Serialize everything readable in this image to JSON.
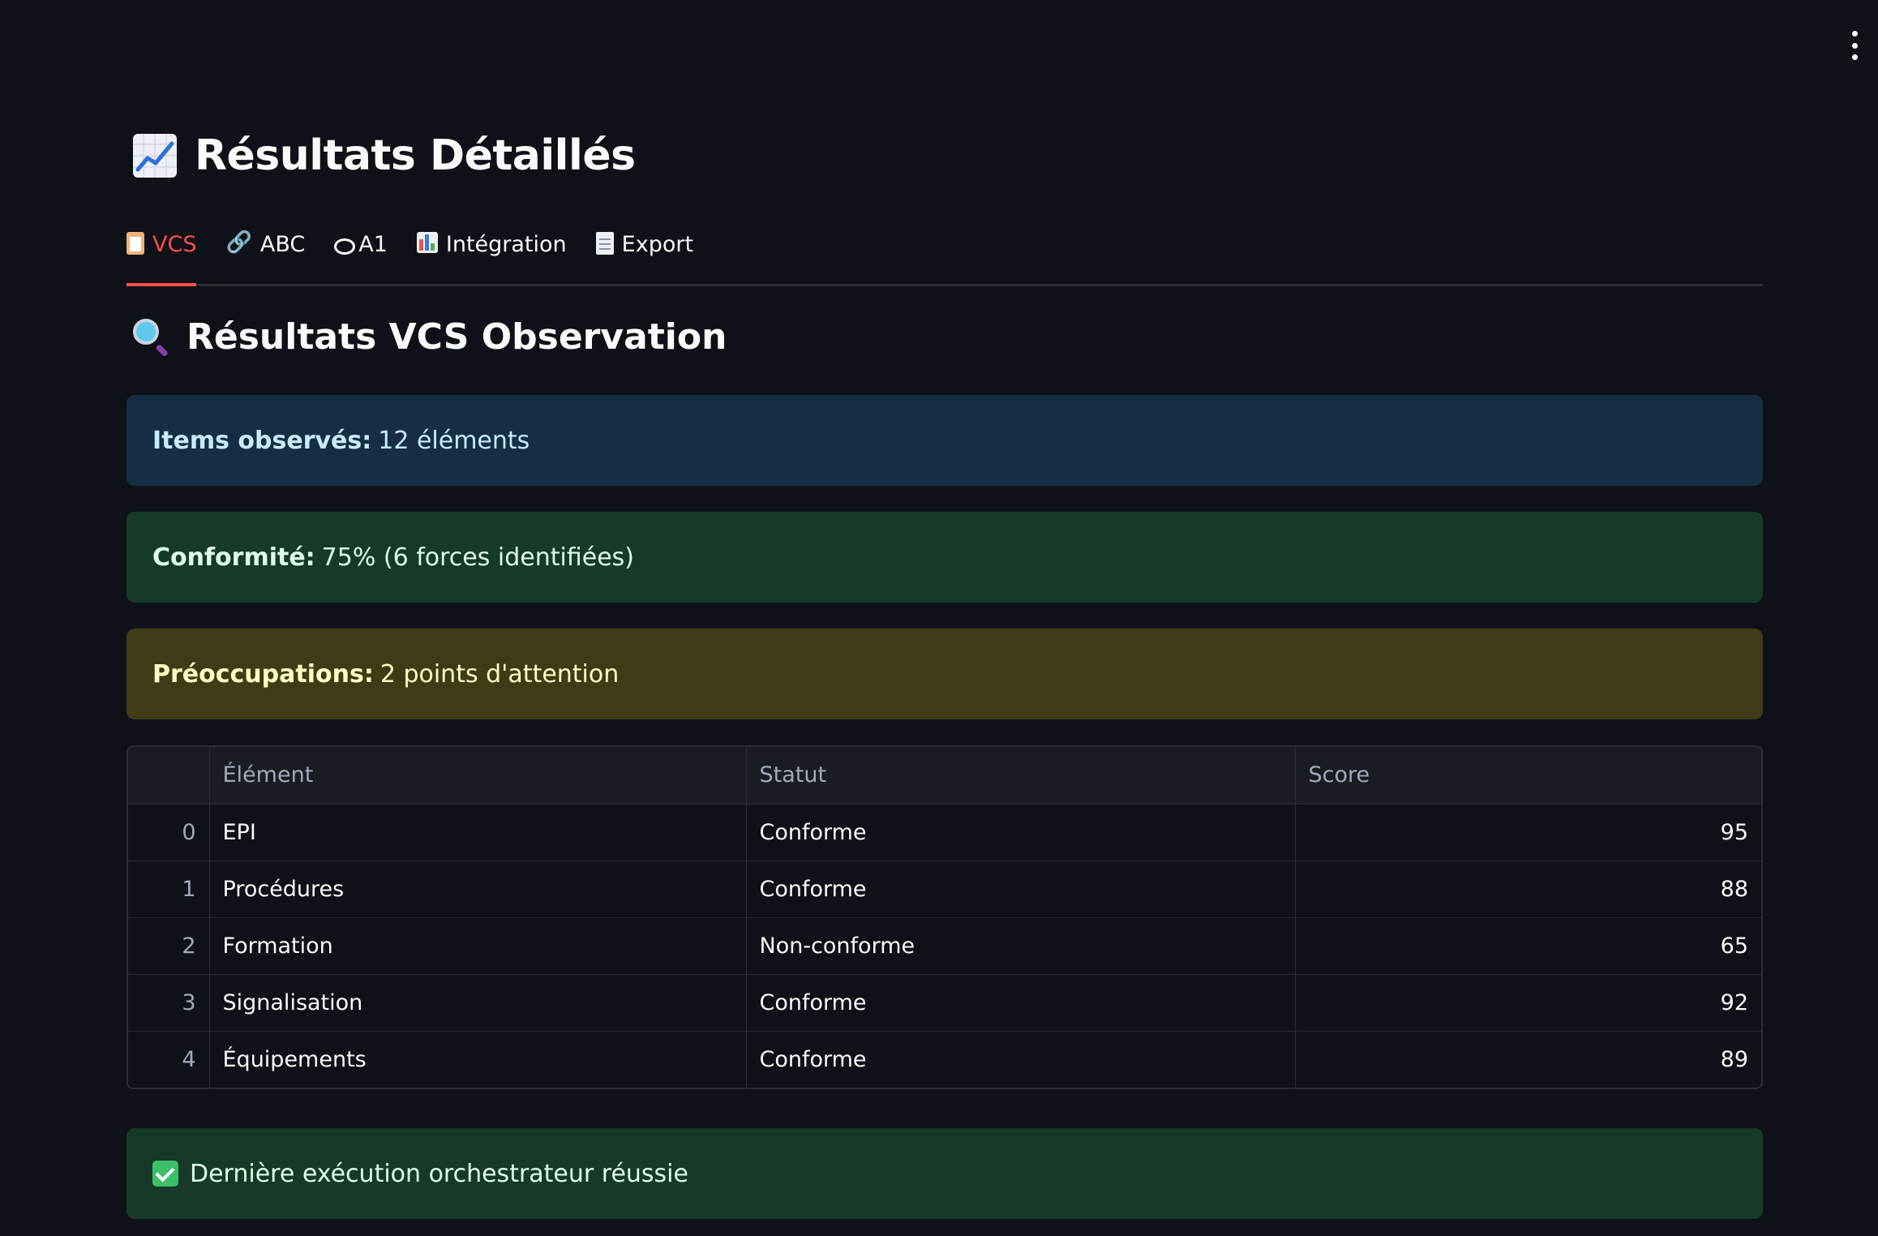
{
  "page": {
    "title": "Résultats Détaillés",
    "title_icon": "chart-increasing-icon"
  },
  "tabs": [
    {
      "label": "VCS",
      "icon": "clipboard-icon",
      "active": true
    },
    {
      "label": "ABC",
      "icon": "link-icon",
      "active": false
    },
    {
      "label": "A1",
      "icon": "eye-icon",
      "active": false
    },
    {
      "label": "Intégration",
      "icon": "bar-chart-icon",
      "active": false
    },
    {
      "label": "Export",
      "icon": "document-icon",
      "active": false
    }
  ],
  "section": {
    "title": "Résultats VCS Observation",
    "icon": "magnifying-glass-icon"
  },
  "alerts": {
    "items_observed": {
      "label": "Items observés:",
      "value": "12 éléments"
    },
    "conformity": {
      "label": "Conformité:",
      "value": "75% (6 forces identifiées)"
    },
    "concerns": {
      "label": "Préoccupations:",
      "value": "2 points d'attention"
    },
    "final": {
      "text": "Dernière exécution orchestrateur réussie",
      "icon": "check-mark-icon"
    }
  },
  "table": {
    "columns": [
      "",
      "Élément",
      "Statut",
      "Score"
    ],
    "rows": [
      {
        "index": "0",
        "element": "EPI",
        "status": "Conforme",
        "score": "95"
      },
      {
        "index": "1",
        "element": "Procédures",
        "status": "Conforme",
        "score": "88"
      },
      {
        "index": "2",
        "element": "Formation",
        "status": "Non-conforme",
        "score": "65"
      },
      {
        "index": "3",
        "element": "Signalisation",
        "status": "Conforme",
        "score": "92"
      },
      {
        "index": "4",
        "element": "Équipements",
        "status": "Conforme",
        "score": "89"
      }
    ]
  },
  "colors": {
    "background": "#0e1117",
    "accent": "#ff4b4b",
    "info_bg": "#172d43",
    "success_bg": "#173928",
    "warning_bg": "#3e3b16"
  }
}
